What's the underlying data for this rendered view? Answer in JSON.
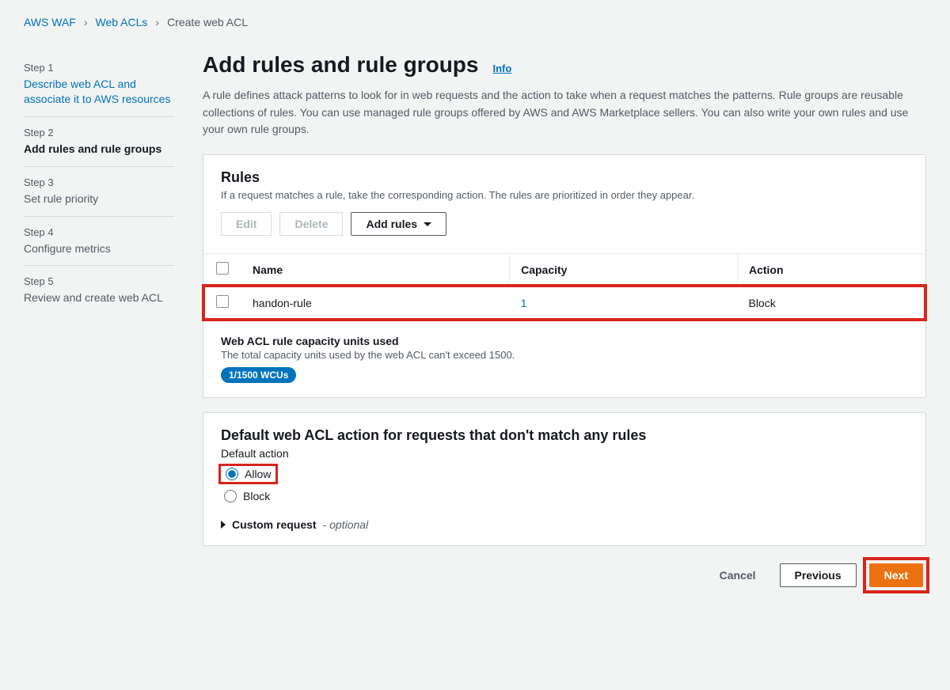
{
  "breadcrumb": {
    "items": [
      "AWS WAF",
      "Web ACLs",
      "Create web ACL"
    ]
  },
  "steps": [
    {
      "num": "Step 1",
      "title": "Describe web ACL and associate it to AWS resources",
      "link": true
    },
    {
      "num": "Step 2",
      "title": "Add rules and rule groups",
      "active": true
    },
    {
      "num": "Step 3",
      "title": "Set rule priority"
    },
    {
      "num": "Step 4",
      "title": "Configure metrics"
    },
    {
      "num": "Step 5",
      "title": "Review and create web ACL"
    }
  ],
  "header": {
    "title": "Add rules and rule groups",
    "info": "Info",
    "description": "A rule defines attack patterns to look for in web requests and the action to take when a request matches the patterns. Rule groups are reusable collections of rules. You can use managed rule groups offered by AWS and AWS Marketplace sellers. You can also write your own rules and use your own rule groups."
  },
  "rulesPanel": {
    "title": "Rules",
    "subtitle": "If a request matches a rule, take the corresponding action. The rules are prioritized in order they appear.",
    "buttons": {
      "edit": "Edit",
      "delete": "Delete",
      "add": "Add rules"
    },
    "columns": {
      "name": "Name",
      "capacity": "Capacity",
      "action": "Action"
    },
    "rows": [
      {
        "name": "handon-rule",
        "capacity": "1",
        "action": "Block"
      }
    ]
  },
  "capacity": {
    "title": "Web ACL rule capacity units used",
    "subtitle": "The total capacity units used by the web ACL can't exceed 1500.",
    "badge": "1/1500 WCUs"
  },
  "defaultAction": {
    "title": "Default web ACL action for requests that don't match any rules",
    "label": "Default action",
    "options": {
      "allow": "Allow",
      "block": "Block"
    },
    "custom": {
      "label": "Custom request",
      "suffix": "- optional"
    }
  },
  "footer": {
    "cancel": "Cancel",
    "previous": "Previous",
    "next": "Next"
  }
}
